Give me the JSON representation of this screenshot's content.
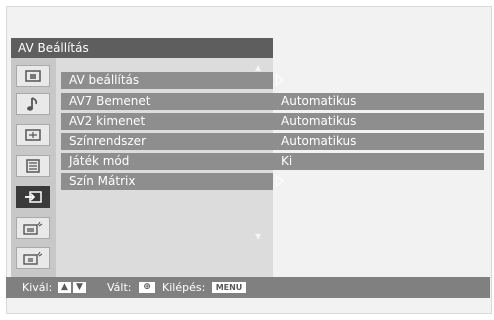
{
  "menu": {
    "title": "AV Beállítás",
    "items": [
      {
        "label": "AV beállítás",
        "value": ""
      },
      {
        "label": "AV7 Bemenet",
        "value": "Automatikus"
      },
      {
        "label": "AV2 kimenet",
        "value": "Automatikus"
      },
      {
        "label": "Színrendszer",
        "value": "Automatikus"
      },
      {
        "label": "Játék mód",
        "value": "Ki"
      },
      {
        "label": "Szín Mátrix",
        "value": ""
      }
    ]
  },
  "icons": [
    "picture-icon",
    "sound-icon",
    "screen-icon",
    "features-icon",
    "input-icon",
    "pc-settings-icon",
    "setup-icon"
  ],
  "footer": {
    "select_label": "Kivál:",
    "change_label": "Vált:",
    "exit_label": "Kilépés:",
    "exit_key": "MENU"
  },
  "colors": {
    "title_bar": "#5e5e5e",
    "row_highlight": "#8e8e8e",
    "footer": "#808080",
    "selected_icon": "#3a3a3a"
  }
}
